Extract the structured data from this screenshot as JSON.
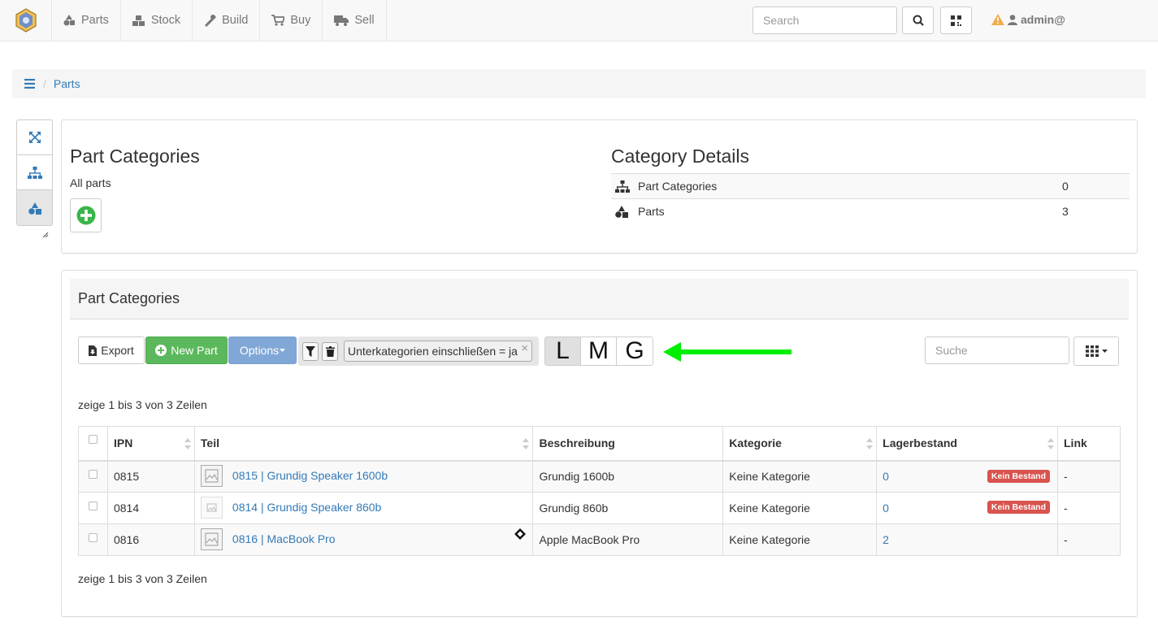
{
  "nav": {
    "items": [
      {
        "label": "Parts",
        "icon": "shapes-icon"
      },
      {
        "label": "Stock",
        "icon": "boxes-icon"
      },
      {
        "label": "Build",
        "icon": "tools-icon"
      },
      {
        "label": "Buy",
        "icon": "cart-icon"
      },
      {
        "label": "Sell",
        "icon": "truck-icon"
      }
    ],
    "search_placeholder": "Search",
    "user": "admin@"
  },
  "breadcrumb": {
    "link": "Parts"
  },
  "top_panel": {
    "categories_title": "Part Categories",
    "categories_sub": "All parts",
    "details_title": "Category Details",
    "details": [
      {
        "label": "Part Categories",
        "value": "0"
      },
      {
        "label": "Parts",
        "value": "3"
      }
    ]
  },
  "main_panel": {
    "heading": "Part Categories",
    "export_label": "Export",
    "new_part_label": "New Part",
    "options_label": "Options",
    "filter_chip": "Unterkategorien einschließen = ja",
    "filter_chip_close": "×",
    "lmg": [
      "L",
      "M",
      "G"
    ],
    "search_placeholder": "Suche",
    "pagination_text": "zeige 1 bis 3 von 3 Zeilen",
    "columns": [
      "IPN",
      "Teil",
      "Beschreibung",
      "Kategorie",
      "Lagerbestand",
      "Link"
    ],
    "rows": [
      {
        "ipn": "0815",
        "part": "0815 | Grundig Speaker 1600b",
        "desc": "Grundig 1600b",
        "cat": "Keine Kategorie",
        "stock": "0",
        "badge": "Kein Bestand",
        "link": "-"
      },
      {
        "ipn": "0814",
        "part": "0814 | Grundig Speaker 860b",
        "desc": "Grundig 860b",
        "cat": "Keine Kategorie",
        "stock": "0",
        "badge": "Kein Bestand",
        "link": "-"
      },
      {
        "ipn": "0816",
        "part": "0816 | MacBook Pro",
        "desc": "Apple MacBook Pro",
        "cat": "Keine Kategorie",
        "stock": "2",
        "badge": "",
        "link": "-"
      }
    ]
  },
  "colors": {
    "link": "#337ab7",
    "success": "#5cb85c",
    "options": "#81a7d6",
    "danger": "#d9534f",
    "arrow": "#00ee00"
  }
}
